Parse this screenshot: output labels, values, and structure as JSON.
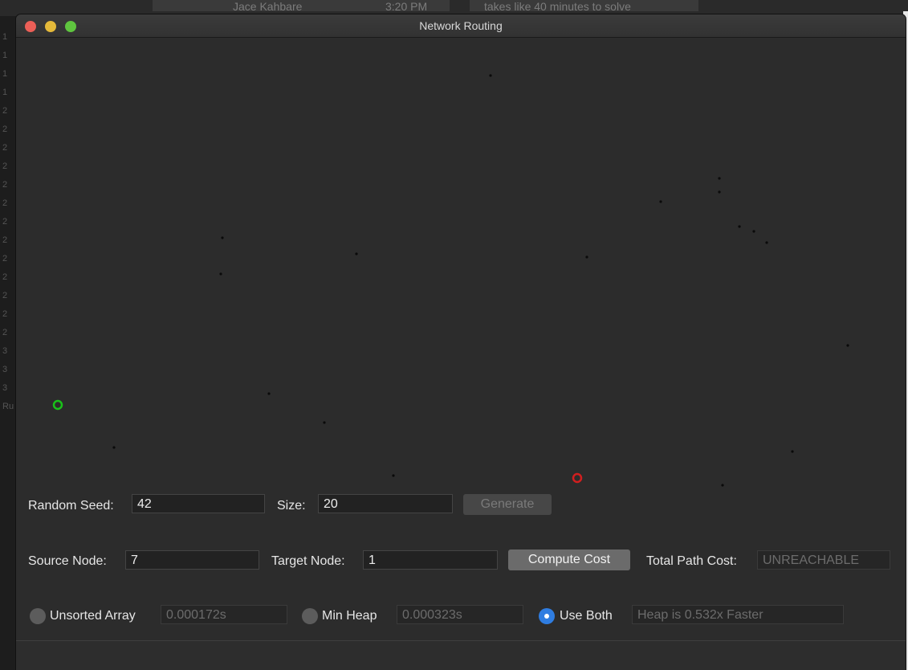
{
  "background": {
    "chat_name": "Jace Kahbare",
    "chat_time": "3:20 PM",
    "chat_message": "takes like 40 minutes to solve",
    "left_glyphs": [
      "1",
      "1",
      "1",
      "1",
      "2",
      "2",
      "2",
      "2",
      "2",
      "2",
      "2",
      "2",
      "2",
      "2",
      "2",
      "2",
      "2",
      "3",
      "3",
      "3",
      "Ru"
    ]
  },
  "window": {
    "title": "Network Routing"
  },
  "graph": {
    "source_color": "#19c119",
    "target_color": "#d11f1f",
    "node_color": "#0a0a0a"
  },
  "controls": {
    "seed_label": "Random Seed:",
    "seed_value": "42",
    "size_label": "Size:",
    "size_value": "20",
    "generate_label": "Generate",
    "source_label": "Source Node:",
    "source_value": "7",
    "target_label": "Target Node:",
    "target_value": "1",
    "compute_label": "Compute Cost",
    "total_cost_label": "Total Path Cost:",
    "total_cost_value": "UNREACHABLE",
    "radio_unsorted_label": "Unsorted Array",
    "unsorted_time": "0.000172s",
    "radio_heap_label": "Min Heap",
    "heap_time": "0.000323s",
    "radio_both_label": "Use Both",
    "comparison_text": "Heap is 0.532x Faster",
    "selected_mode": "Use Both"
  }
}
